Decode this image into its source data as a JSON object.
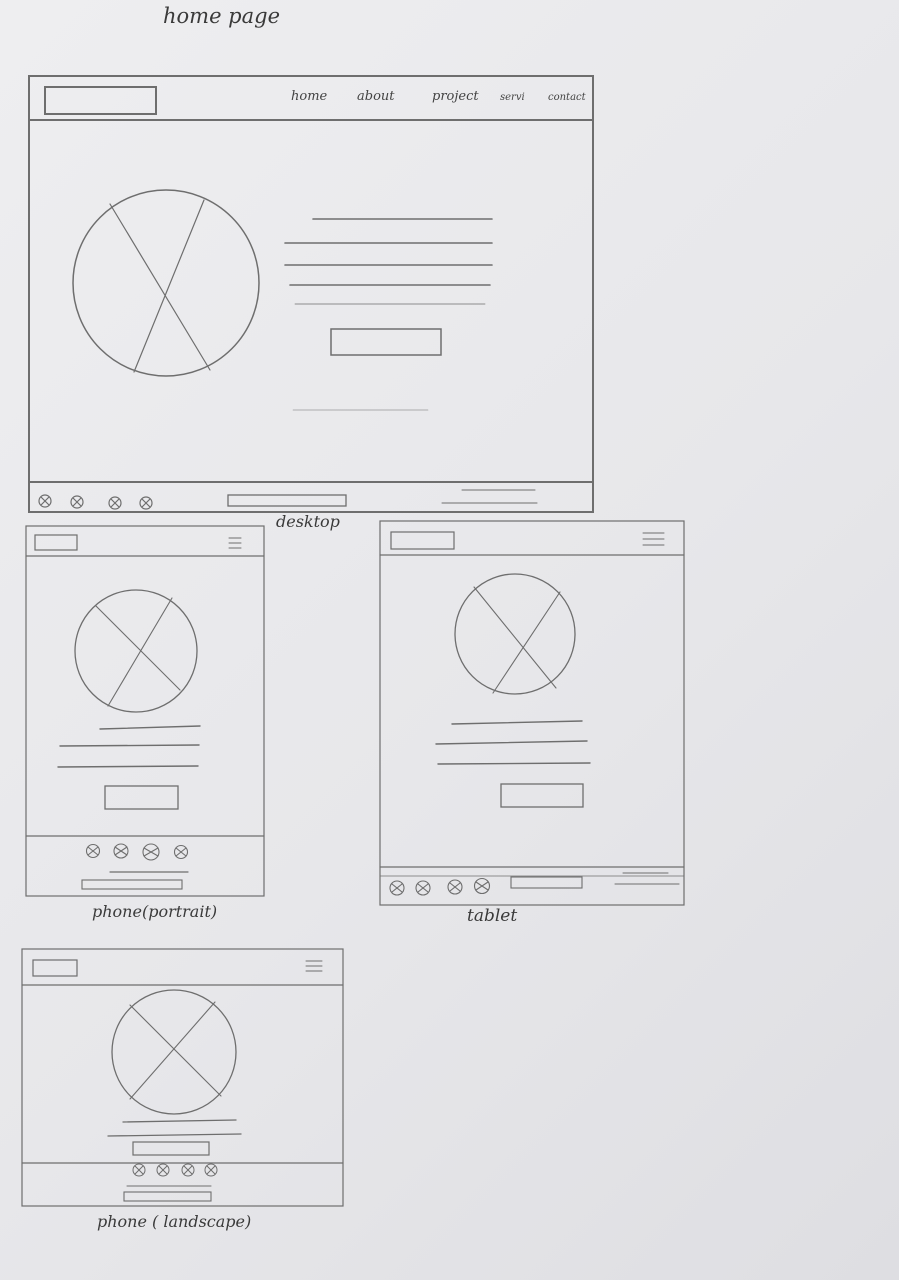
{
  "page_title": "home page",
  "desktop": {
    "nav": [
      "home",
      "about",
      "project",
      "servi",
      "contact"
    ],
    "label": "desktop"
  },
  "phone_portrait": {
    "label": "phone(portrait)"
  },
  "tablet": {
    "label": "tablet"
  },
  "phone_landscape": {
    "label": "phone ( landscape)"
  },
  "colors": {
    "paper": "#e9e9eb",
    "pencil": "#6e6e6e",
    "ink": "#3a3a3a"
  }
}
